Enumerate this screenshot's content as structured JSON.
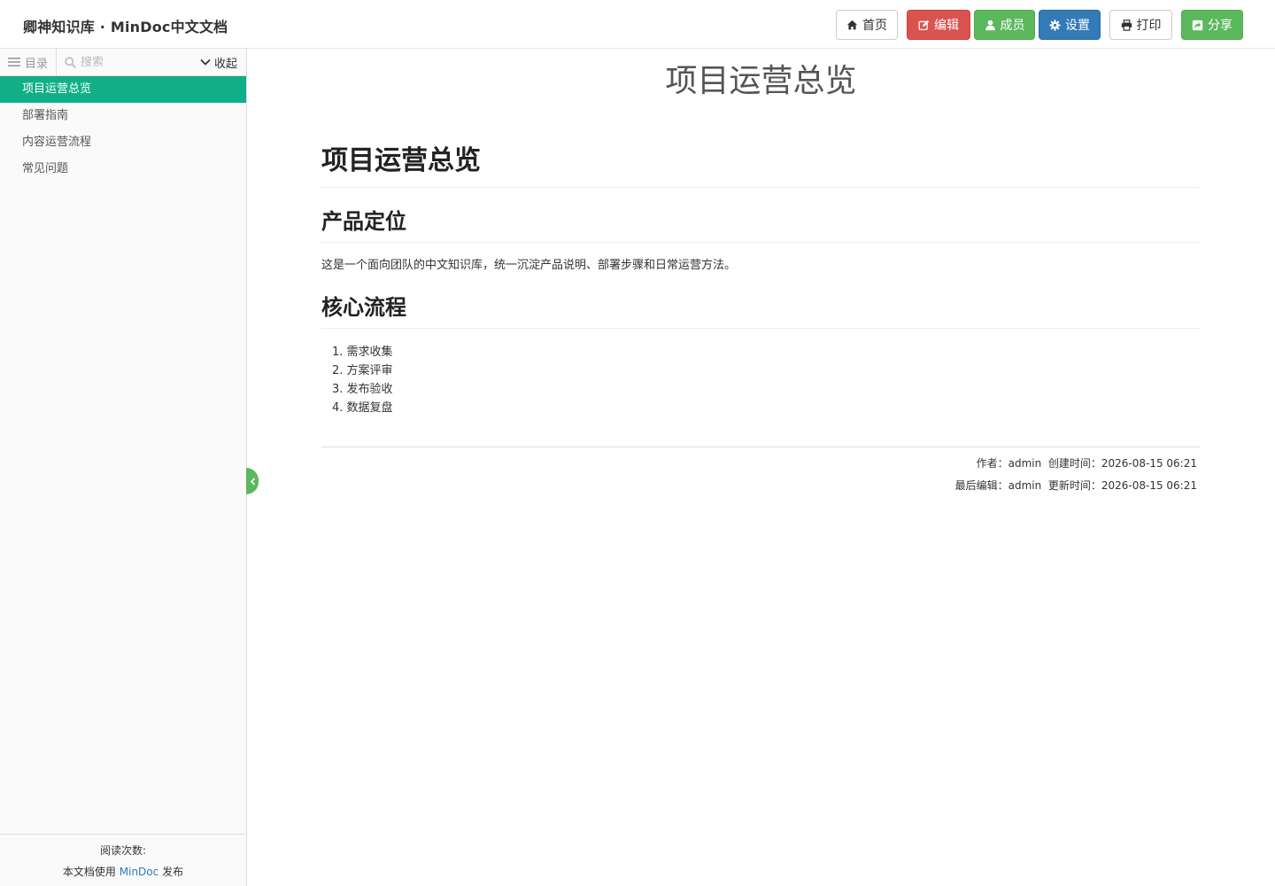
{
  "header": {
    "brand": "卿神知识库 · MinDoc中文文档",
    "buttons": {
      "home": "首页",
      "edit": "编辑",
      "members": "成员",
      "settings": "设置",
      "print": "打印",
      "share": "分享"
    }
  },
  "sidebar": {
    "toc_tab": "目录",
    "search_placeholder": "搜索",
    "collapse": "收起",
    "items": [
      {
        "label": "项目运营总览",
        "active": true
      },
      {
        "label": "部署指南",
        "active": false
      },
      {
        "label": "内容运营流程",
        "active": false
      },
      {
        "label": "常见问题",
        "active": false
      }
    ],
    "footer": {
      "reads": "阅读次数:",
      "powered_prefix": "本文档使用",
      "powered_link": "MinDoc",
      "powered_suffix": "发布"
    }
  },
  "document": {
    "title": "项目运营总览",
    "h1": "项目运营总览",
    "section1_heading": "产品定位",
    "section1_text": "这是一个面向团队的中文知识库，统一沉淀产品说明、部署步骤和日常运营方法。",
    "section2_heading": "核心流程",
    "steps": [
      "1. 需求收集",
      "2. 方案评审",
      "3. 发布验收",
      "4. 数据复盘"
    ],
    "meta_line1": "作者：admin  创建时间：2026-08-15 06:21",
    "meta_line2": "最后编辑：admin  更新时间：2026-08-15 06:21"
  },
  "colors": {
    "active_toc": "#10af88",
    "danger": "#d9534f",
    "success": "#5cb85c",
    "primary": "#337ab7"
  }
}
